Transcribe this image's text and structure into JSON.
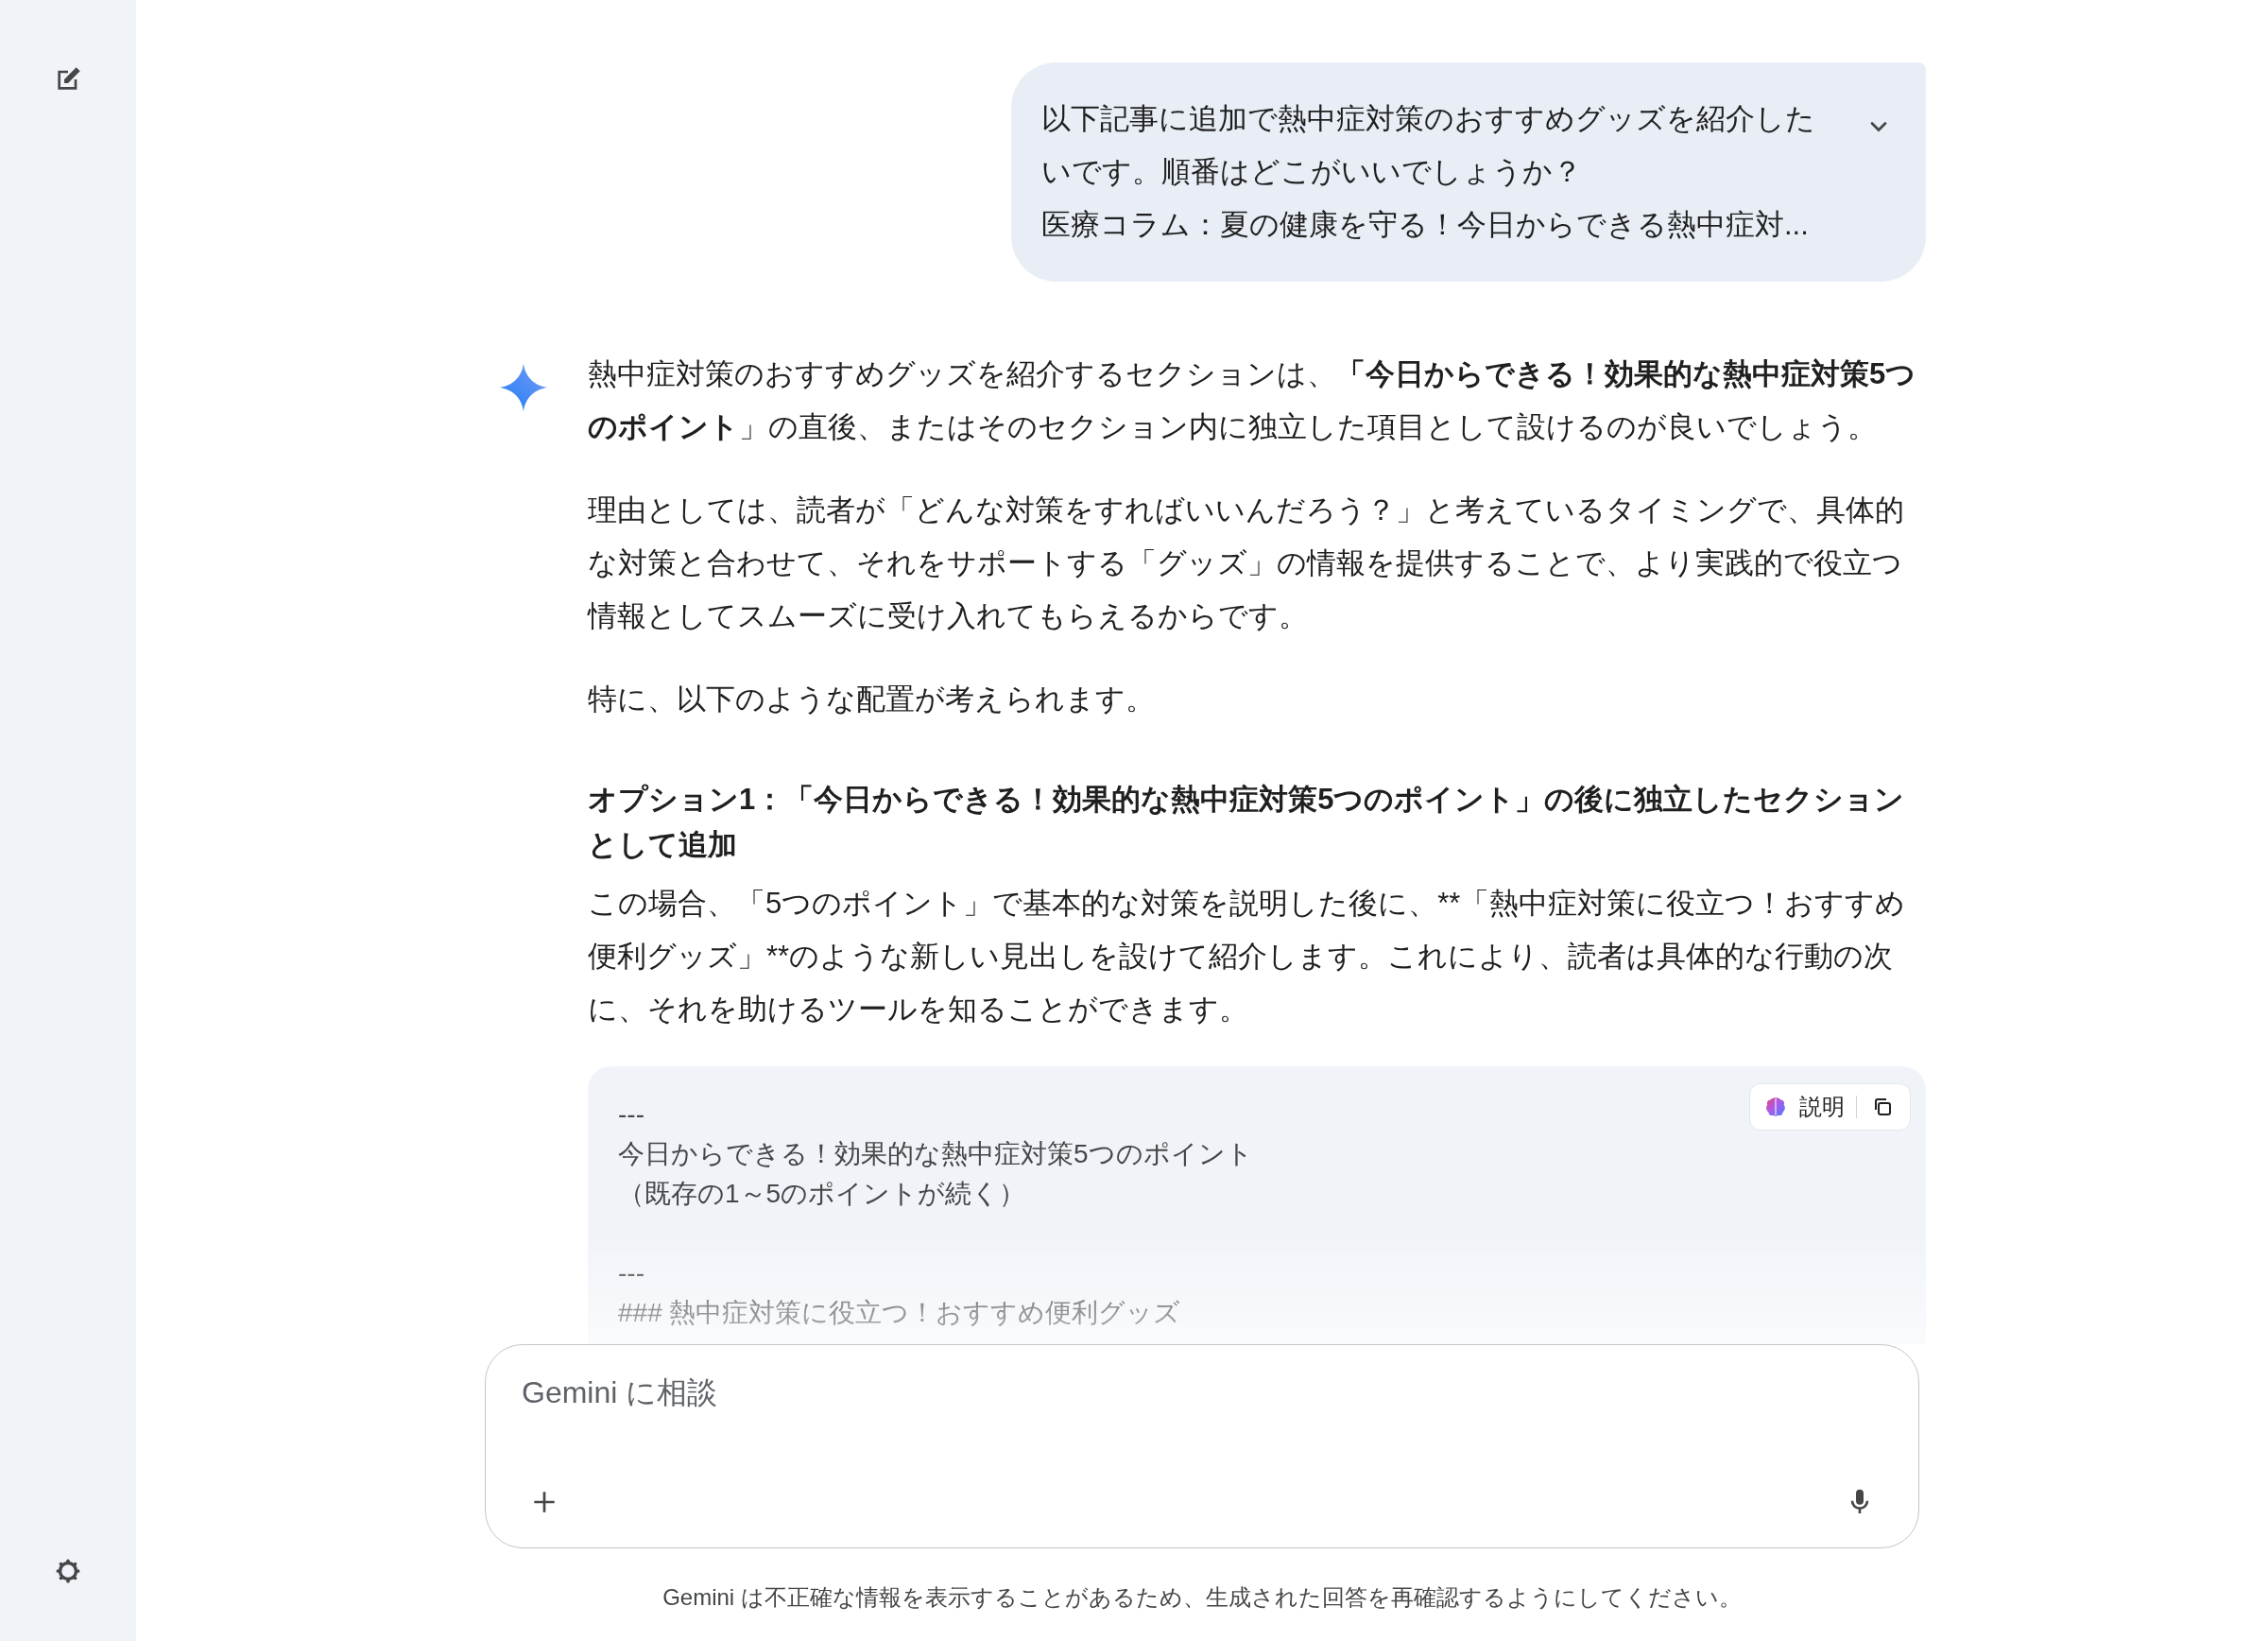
{
  "user_message": {
    "lines": [
      "以下記事に追加で熱中症対策のおすすめグッズを紹介したいです。順番はどこがいいでしょうか？",
      "医療コラム：夏の健康を守る！今日からできる熱中症対..."
    ],
    "expanded": false
  },
  "response": {
    "blocks": [
      {
        "kind": "paragraph",
        "text": "熱中症対策のおすすめグッズを紹介するセクションは、**「今日からできる！効果的な熱中症対策5つのポイント**」の直後、またはそのセクション内に独立した項目として設けるのが良いでしょう。"
      },
      {
        "kind": "paragraph",
        "text": "理由としては、読者が「どんな対策をすればいいんだろう？」と考えているタイミングで、具体的な対策と合わせて、それをサポートする「グッズ」の情報を提供することで、より実践的で役立つ情報としてスムーズに受け入れてもらえるからです。"
      },
      {
        "kind": "paragraph",
        "text": "特に、以下のような配置が考えられます。"
      },
      {
        "kind": "heading",
        "text": "オプション1：「今日からできる！効果的な熱中症対策5つのポイント」の後に独立したセクションとして追加"
      },
      {
        "kind": "literal",
        "text": "この場合、「5つのポイント」で基本的な対策を説明した後に、**「熱中症対策に役立つ！おすすめ便利グッズ」**のような新しい見出しを設けて紹介します。これにより、読者は具体的な行動の次に、それを助けるツールを知ることができます。"
      }
    ],
    "code_block": {
      "sections": [
        [
          "---",
          "今日からできる！効果的な熱中症対策5つのポイント",
          "（既存の1～5のポイントが続く）"
        ],
        [
          "---",
          "### 熱中症対策に役立つ！おすすめ便利グッズ"
        ]
      ],
      "explain_button": "説明"
    }
  },
  "input": {
    "placeholder": "Gemini に相談"
  },
  "disclaimer": "Gemini は不正確な情報を表示することがあるため、生成された回答を再確認するようにしてください。"
}
